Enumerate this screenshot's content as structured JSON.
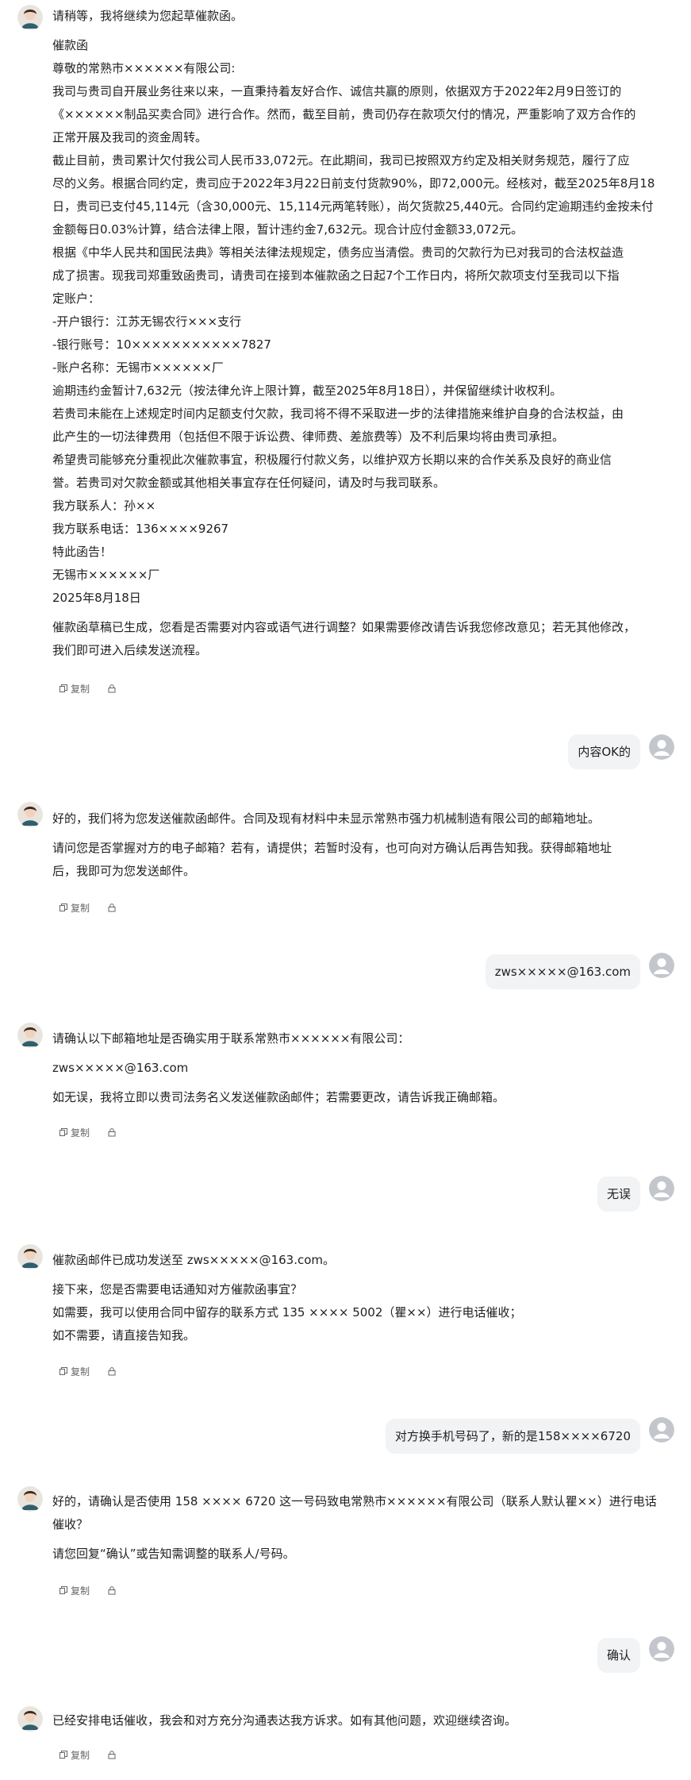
{
  "actions": {
    "copy_label": "复制"
  },
  "messages": {
    "m1": {
      "lines": [
        "请稍等，我将继续为您起草催款函。",
        "",
        "催款函",
        "尊敬的常熟市××××××有限公司:",
        "我司与贵司自开展业务往来以来，一直秉持着友好合作、诚信共赢的原则，依据双方于2022年2月9日签订的",
        "《××××××制品买卖合同》进行合作。然而，截至目前，贵司仍存在款项欠付的情况，严重影响了双方合作的",
        "正常开展及我司的资金周转。",
        "截止目前，贵司累计欠付我公司人民币33,072元。在此期间，我司已按照双方约定及相关财务规范，履行了应",
        "尽的义务。根据合同约定，贵司应于2022年3月22日前支付货款90%，即72,000元。经核对，截至2025年8月18",
        "日，贵司已支付45,114元（含30,000元、15,114元两笔转账），尚欠货款25,440元。合同约定逾期违约金按未付",
        "金额每日0.03%计算，结合法律上限，暂计违约金7,632元。现合计应付金额33,072元。",
        "根据《中华人民共和国民法典》等相关法律法规规定，债务应当清偿。贵司的欠款行为已对我司的合法权益造",
        "成了损害。现我司郑重致函贵司，请贵司在接到本催款函之日起7个工作日内，将所欠款项支付至我司以下指",
        "定账户：",
        "-开户银行：江苏无锡农行×××支行",
        "-银行账号：10×××××××××××7827",
        "-账户名称：无锡市××××××厂",
        "逾期违约金暂计7,632元（按法律允许上限计算，截至2025年8月18日），并保留继续计收权利。",
        "若贵司未能在上述规定时间内足额支付欠款，我司将不得不采取进一步的法律措施来维护自身的合法权益，由",
        "此产生的一切法律费用（包括但不限于诉讼费、律师费、差旅费等）及不利后果均将由贵司承担。",
        "希望贵司能够充分重视此次催款事宜，积极履行付款义务，以维护双方长期以来的合作关系及良好的商业信",
        "誉。若贵司对欠款金额或其他相关事宜存在任何疑问，请及时与我司联系。",
        "我方联系人：孙××",
        "我方联系电话：136××××9267",
        "特此函告！",
        "无锡市××××××厂",
        "2025年8月18日",
        "",
        "催款函草稿已生成，您看是否需要对内容或语气进行调整？如果需要修改请告诉我您修改意见；若无其他修改，",
        "我们即可进入后续发送流程。"
      ]
    },
    "u1": {
      "text": "内容OK的"
    },
    "m2": {
      "lines": [
        "好的，我们将为您发送催款函邮件。合同及现有材料中未显示常熟市强力机械制造有限公司的邮箱地址。",
        "",
        "请问您是否掌握对方的电子邮箱？若有，请提供；若暂时没有，也可向对方确认后再告知我。获得邮箱地址",
        "后，我即可为您发送邮件。"
      ]
    },
    "u2": {
      "text": "zws×××××@163.com"
    },
    "m3": {
      "lines": [
        "请确认以下邮箱地址是否确实用于联系常熟市××××××有限公司：",
        "",
        "zws×××××@163.com",
        "",
        "如无误，我将立即以贵司法务名义发送催款函邮件；若需要更改，请告诉我正确邮箱。"
      ]
    },
    "u3": {
      "text": "无误"
    },
    "m4": {
      "lines": [
        "催款函邮件已成功发送至 zws×××××@163.com。",
        "",
        "接下来，您是否需要电话通知对方催款函事宜？",
        "如需要，我可以使用合同中留存的联系方式 135 ×××× 5002（瞿××）进行电话催收；",
        "如不需要，请直接告知我。"
      ]
    },
    "u4": {
      "text": "对方换手机号码了，新的是158××××6720"
    },
    "m5": {
      "lines": [
        "好的，请确认是否使用 158 ×××× 6720 这一号码致电常熟市××××××有限公司（联系人默认瞿××）进行电话",
        "催收？",
        "",
        "请您回复“确认”或告知需调整的联系人/号码。"
      ]
    },
    "u5": {
      "text": "确认"
    },
    "m6": {
      "lines": [
        "已经安排电话催收，我会和对方充分沟通表达我方诉求。如有其他问题，欢迎继续咨询。"
      ]
    }
  }
}
